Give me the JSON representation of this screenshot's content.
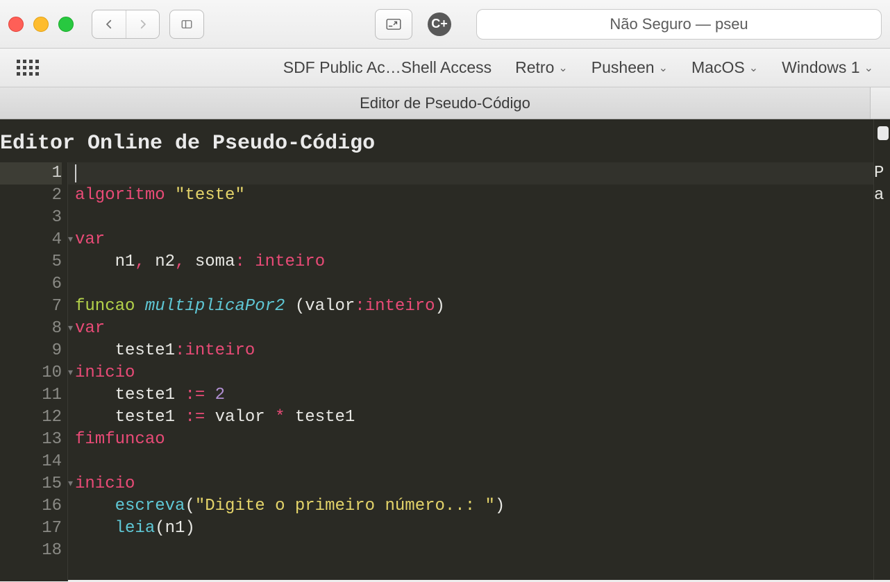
{
  "browser": {
    "address_text": "Não Seguro — pseu"
  },
  "bookmarks": {
    "items": [
      {
        "label": "SDF Public Ac…Shell Access",
        "has_menu": false
      },
      {
        "label": "Retro",
        "has_menu": true
      },
      {
        "label": "Pusheen",
        "has_menu": true
      },
      {
        "label": "MacOS",
        "has_menu": true
      },
      {
        "label": "Windows 1",
        "has_menu": true
      }
    ]
  },
  "tab": {
    "title": "Editor de Pseudo-Código"
  },
  "page": {
    "title": "Editor Online de Pseudo-Código"
  },
  "editor": {
    "line_count": 18,
    "fold_lines": [
      4,
      8,
      10,
      15
    ],
    "lines": [
      "",
      "algoritmo \"teste\"",
      "",
      "var",
      "    n1, n2, soma: inteiro",
      "",
      "funcao multiplicaPor2 (valor:inteiro)",
      "var",
      "    teste1:inteiro",
      "inicio",
      "    teste1 := 2",
      "    teste1 := valor * teste1",
      "fimfuncao",
      "",
      "inicio",
      "    escreva(\"Digite o primeiro número..: \")",
      "    leia(n1)",
      ""
    ],
    "tokens": [
      [],
      [
        [
          "kw-pink",
          "algoritmo"
        ],
        [
          "plain",
          " "
        ],
        [
          "str",
          "\"teste\""
        ]
      ],
      [],
      [
        [
          "kw-pink",
          "var"
        ]
      ],
      [
        [
          "plain",
          "    n1"
        ],
        [
          "op-pink",
          ","
        ],
        [
          "plain",
          " n2"
        ],
        [
          "op-pink",
          ","
        ],
        [
          "plain",
          " soma"
        ],
        [
          "op-pink",
          ":"
        ],
        [
          "plain",
          " "
        ],
        [
          "kw-type",
          "inteiro"
        ]
      ],
      [],
      [
        [
          "kw-func",
          "funcao"
        ],
        [
          "plain",
          " "
        ],
        [
          "fn-name",
          "multiplicaPor2"
        ],
        [
          "plain",
          " "
        ],
        [
          "paren",
          "("
        ],
        [
          "plain",
          "valor"
        ],
        [
          "op-pink",
          ":"
        ],
        [
          "kw-type",
          "inteiro"
        ],
        [
          "paren",
          ")"
        ]
      ],
      [
        [
          "kw-pink",
          "var"
        ]
      ],
      [
        [
          "plain",
          "    teste1"
        ],
        [
          "op-pink",
          ":"
        ],
        [
          "kw-type",
          "inteiro"
        ]
      ],
      [
        [
          "kw-pink",
          "inicio"
        ]
      ],
      [
        [
          "plain",
          "    teste1 "
        ],
        [
          "op-pink",
          ":="
        ],
        [
          "plain",
          " "
        ],
        [
          "num-lav",
          "2"
        ]
      ],
      [
        [
          "plain",
          "    teste1 "
        ],
        [
          "op-pink",
          ":="
        ],
        [
          "plain",
          " valor "
        ],
        [
          "op-pink",
          "*"
        ],
        [
          "plain",
          " teste1"
        ]
      ],
      [
        [
          "kw-pink",
          "fimfuncao"
        ]
      ],
      [],
      [
        [
          "kw-pink",
          "inicio"
        ]
      ],
      [
        [
          "plain",
          "    "
        ],
        [
          "fn-call",
          "escreva"
        ],
        [
          "paren",
          "("
        ],
        [
          "str",
          "\"Digite o primeiro número..: \""
        ],
        [
          "paren",
          ")"
        ]
      ],
      [
        [
          "plain",
          "    "
        ],
        [
          "fn-call",
          "leia"
        ],
        [
          "paren",
          "("
        ],
        [
          "plain",
          "n1"
        ],
        [
          "paren",
          ")"
        ]
      ],
      []
    ]
  },
  "side_panel": {
    "line1": "P",
    "line2": "a"
  }
}
